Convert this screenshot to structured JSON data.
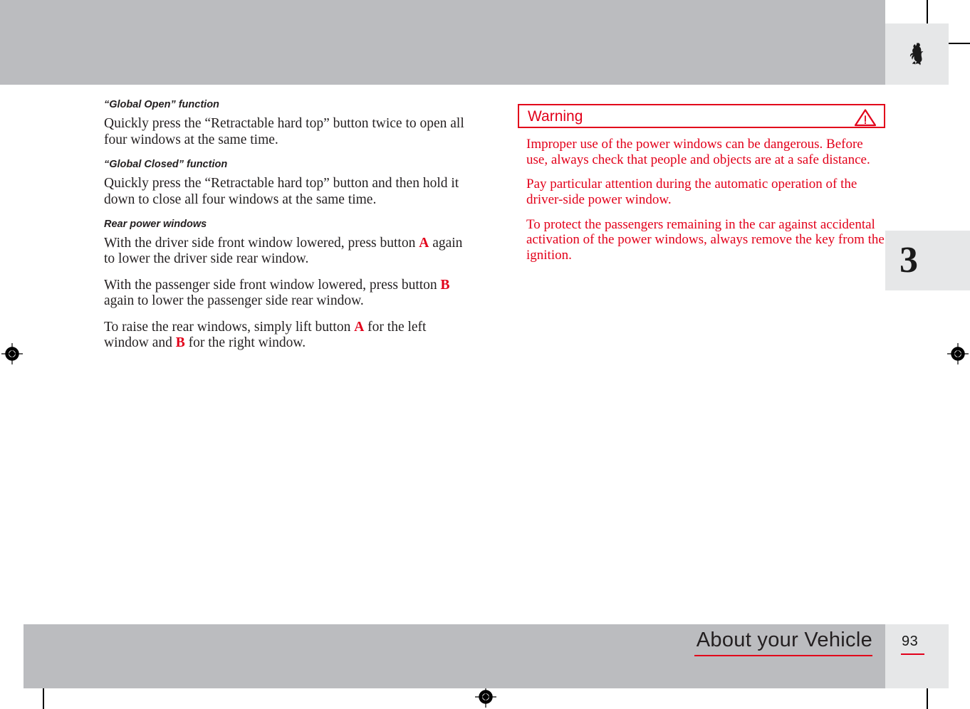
{
  "page": {
    "chapter_number": "3",
    "page_number": "93",
    "footer_title": "About your Vehicle",
    "logo_name": "ferrari-prancing-horse-logo"
  },
  "colors": {
    "accent_red": "#e2001a",
    "band_gray": "#bbbcbf",
    "tab_gray": "#e6e7e8",
    "text_black": "#231f20"
  },
  "left_column": {
    "sections": [
      {
        "heading": "“Global Open” function",
        "paragraph": "Quickly press the “Retractable hard top” button twice to open all four windows at the same time."
      },
      {
        "heading": "“Global Closed” function",
        "paragraph": "Quickly press the “Retractable hard top” button and then hold it down to close all four windows at the same time."
      }
    ],
    "rear_windows": {
      "heading": "Rear power windows",
      "paragraphs": [
        {
          "part1": "With the driver side front window lowered, press button ",
          "ref1": "A",
          "part2": " again to lower the driver side rear window.",
          "ref2": "",
          "part3": ""
        },
        {
          "part1": "With the passenger side front window lowered, press button ",
          "ref1": "B",
          "part2": " again to lower the passenger side rear window.",
          "ref2": "",
          "part3": ""
        },
        {
          "part1": "To raise the rear windows, simply lift button ",
          "ref1": "A",
          "part2": " for the left window and ",
          "ref2": "B",
          "part3": " for the right window."
        }
      ]
    }
  },
  "warning": {
    "label": "Warning",
    "icon_name": "warning-triangle-icon",
    "paragraphs": [
      "Improper use of the power windows can be dangerous. Before use, always check that people and objects are at a safe distance.",
      "Pay particular attention during the automatic operation of the driver-side power window.",
      "To protect the passengers remaining in the car against accidental activation of the power windows, always remove the key from the ignition."
    ]
  }
}
